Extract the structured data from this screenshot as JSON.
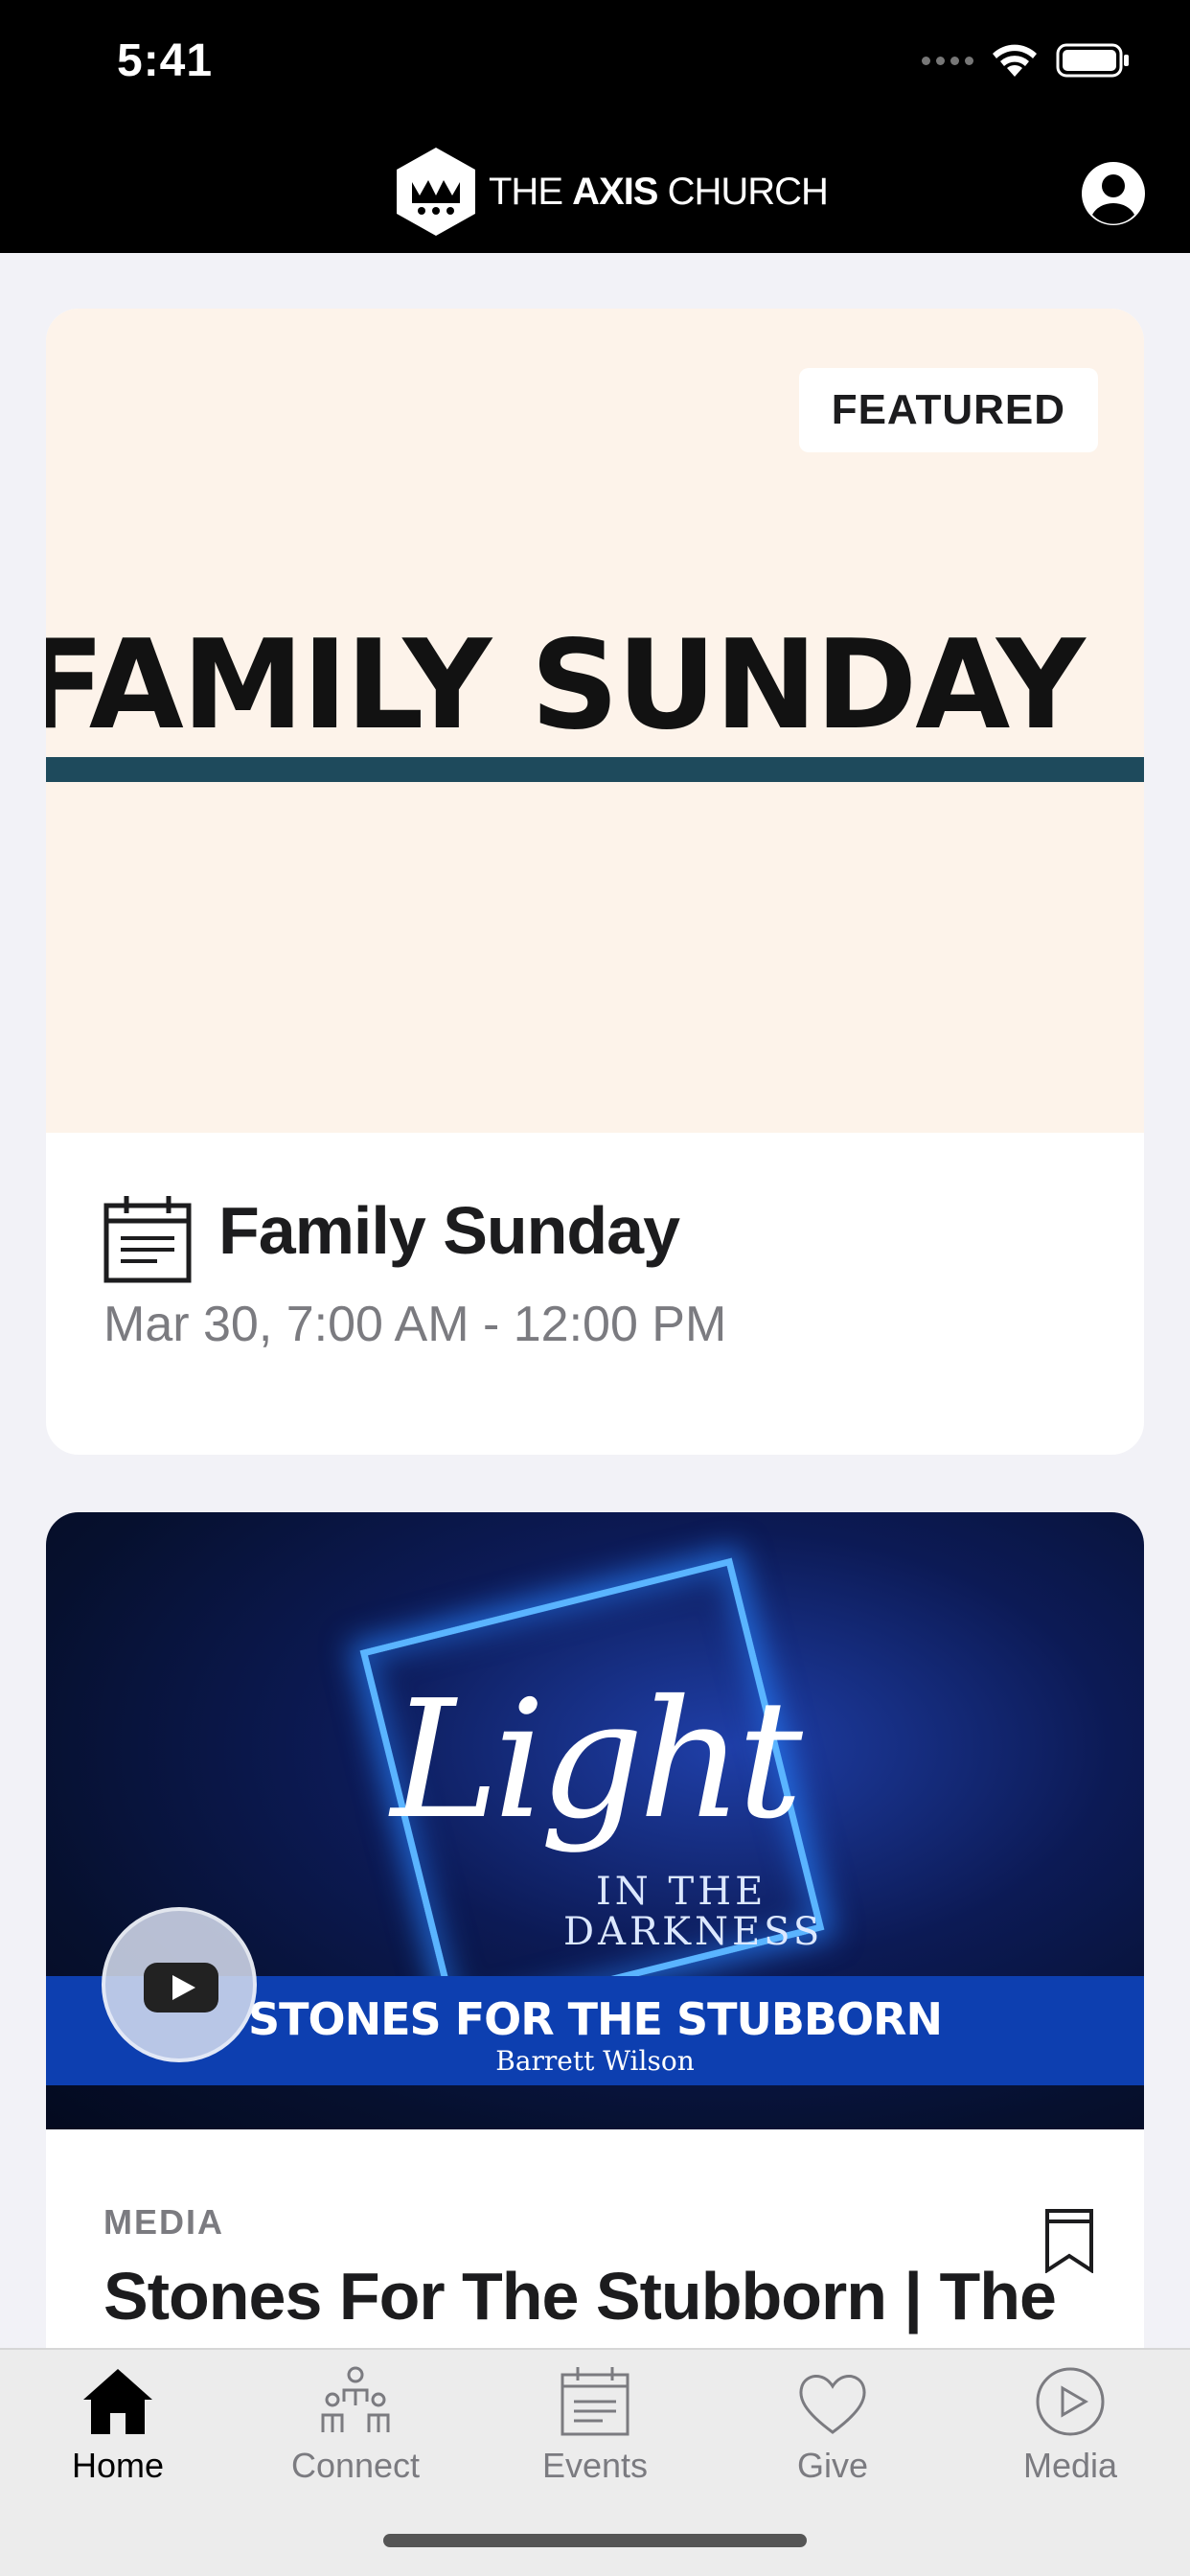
{
  "status_bar": {
    "time": "5:41"
  },
  "header": {
    "logo_prefix": "THE ",
    "logo_bold": "AXIS",
    "logo_suffix": " CHURCH"
  },
  "featured_card": {
    "badge": "FEATURED",
    "image_text": "FAMILY SUNDAY",
    "title": "Family Sunday",
    "datetime": "Mar 30, 7:00 AM - 12:00 PM"
  },
  "media_card": {
    "image_script": "Light",
    "image_subtitle_1": "IN THE",
    "image_subtitle_2": "DARKNESS",
    "image_band_title": "STONES FOR THE STUBBORN",
    "image_band_speaker": "Barrett Wilson",
    "category": "MEDIA",
    "title": "Stones For The Stubborn | The"
  },
  "tabs": [
    {
      "label": "Home",
      "icon": "home-icon",
      "active": true
    },
    {
      "label": "Connect",
      "icon": "people-icon",
      "active": false
    },
    {
      "label": "Events",
      "icon": "calendar-icon",
      "active": false
    },
    {
      "label": "Give",
      "icon": "heart-icon",
      "active": false
    },
    {
      "label": "Media",
      "icon": "play-circle-icon",
      "active": false
    }
  ]
}
